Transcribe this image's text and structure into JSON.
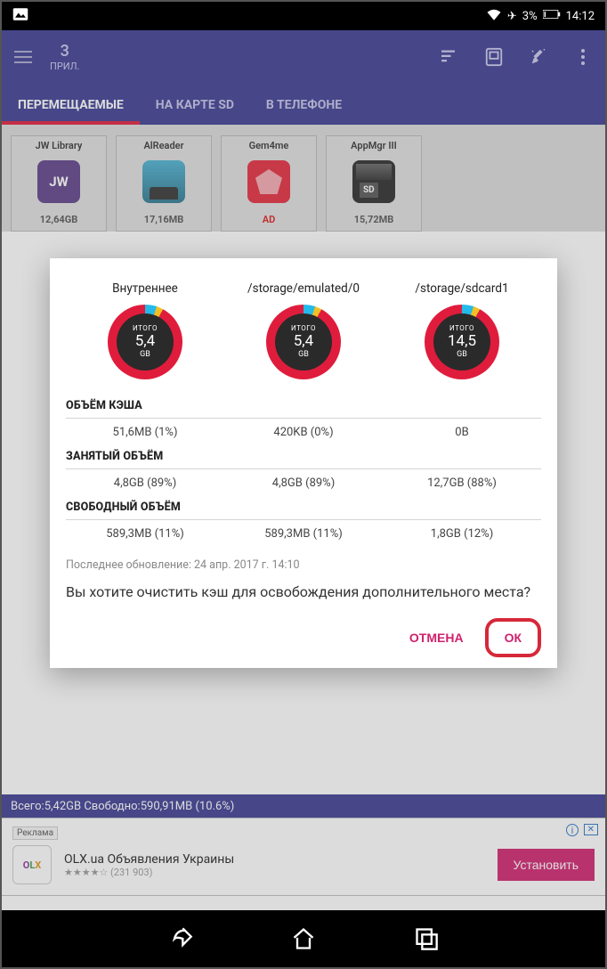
{
  "status": {
    "battery": "3%",
    "time": "14:12"
  },
  "header": {
    "count": "3",
    "label": "ПРИЛ."
  },
  "tabs": [
    {
      "label": "ПЕРЕМЕЩАЕМЫЕ",
      "active": true
    },
    {
      "label": "НА КАРТЕ SD",
      "active": false
    },
    {
      "label": "В ТЕЛЕФОНЕ",
      "active": false
    }
  ],
  "apps": [
    {
      "name": "JW Library",
      "size": "12,64GB"
    },
    {
      "name": "AlReader",
      "size": "17,16MB"
    },
    {
      "name": "Gem4me",
      "size": "AD"
    },
    {
      "name": "AppMgr III",
      "size": "15,72MB"
    }
  ],
  "dialog": {
    "storages": [
      {
        "name": "Внутреннее",
        "total": "5,4",
        "unit": "GB",
        "itogo": "ИТОГО"
      },
      {
        "name": "/storage/emulated/0",
        "total": "5,4",
        "unit": "GB",
        "itogo": "ИТОГО"
      },
      {
        "name": "/storage/sdcard1",
        "total": "14,5",
        "unit": "GB",
        "itogo": "ИТОГО"
      }
    ],
    "sections": {
      "cache_label": "ОБЪЁМ КЭША",
      "cache": [
        "51,6MB (1%)",
        "420KB (0%)",
        "0B"
      ],
      "occupied_label": "ЗАНЯТЫЙ ОБЪЁМ",
      "occupied": [
        "4,8GB (89%)",
        "4,8GB (89%)",
        "12,7GB (88%)"
      ],
      "free_label": "СВОБОДНЫЙ ОБЪЁМ",
      "free": [
        "589,3MB (11%)",
        "589,3MB (11%)",
        "1,8GB (12%)"
      ]
    },
    "updated": "Последнее обновление: 24 апр. 2017 г. 14:10",
    "question": "Вы хотите очистить кэш для освобождения дополнительного места?",
    "cancel": "ОТМЕНА",
    "ok": "ОК"
  },
  "bottom_bar": "Всего:5,42GB Свободно:590,91MB (10.6%)",
  "ad": {
    "tag": "Реклама",
    "title": "OLX.ua Объявления Украины",
    "rating": "★★★★☆ (231 903)",
    "install": "Установить"
  }
}
